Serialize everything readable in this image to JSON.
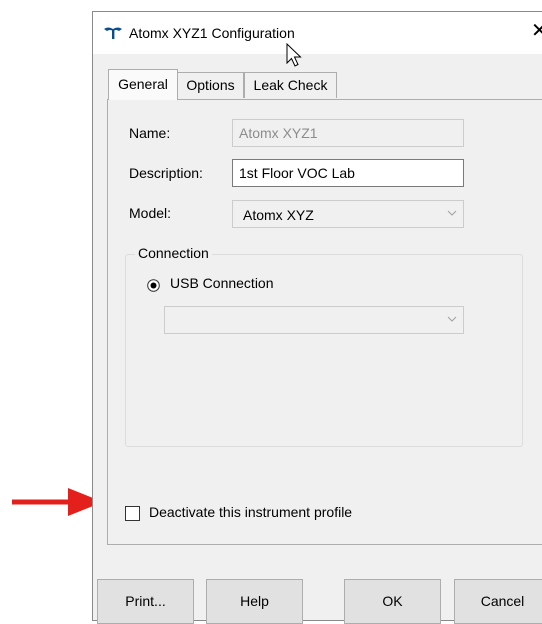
{
  "window": {
    "title": "Atomx XYZ1 Configuration",
    "close_glyph": "✕",
    "icon": "teledyne-logo-icon"
  },
  "tabs": [
    {
      "label": "General",
      "active": true
    },
    {
      "label": "Options",
      "active": false
    },
    {
      "label": "Leak Check",
      "active": false
    }
  ],
  "general": {
    "name_label": "Name:",
    "name_value": "Atomx XYZ1",
    "name_enabled": false,
    "description_label": "Description:",
    "description_value": "1st Floor VOC Lab",
    "model_label": "Model:",
    "model_value": "Atomx XYZ",
    "connection": {
      "caption": "Connection",
      "radio_label": "USB Connection",
      "radio_selected": true,
      "port_value": ""
    },
    "deactivate_label": "Deactivate this instrument profile",
    "deactivate_checked": false
  },
  "buttons": {
    "print": "Print...",
    "help": "Help",
    "ok": "OK",
    "cancel": "Cancel"
  },
  "annotation": {
    "arrow_color": "#e3201b"
  }
}
